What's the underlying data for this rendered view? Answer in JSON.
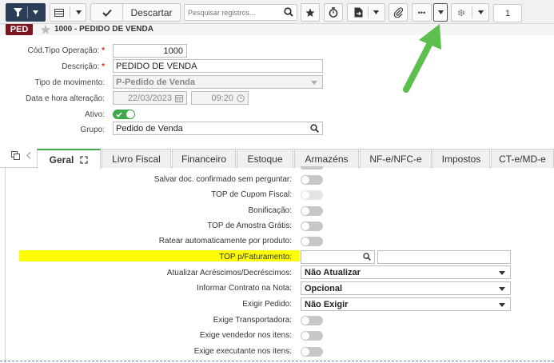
{
  "toolbar": {
    "discard_label": "Descartar",
    "search_placeholder": "Pesquisar registros...",
    "more_label": "•••",
    "page_number": "1"
  },
  "header": {
    "badge": "PED",
    "title": "1000 - PEDIDO DE VENDA"
  },
  "form": {
    "cod_tipo_operacao": {
      "label": "Cód.Tipo Operação:",
      "value": "1000"
    },
    "descricao": {
      "label": "Descrição:",
      "value": "PEDIDO DE VENDA"
    },
    "tipo_movimento": {
      "label": "Tipo de movimento:",
      "value": "P-Pedido de Venda"
    },
    "data_hora": {
      "label": "Data e hora alteração:",
      "date": "22/03/2023",
      "time": "09:20"
    },
    "ativo": {
      "label": "Ativo:",
      "on": true
    },
    "grupo": {
      "label": "Grupo:",
      "value": "Pedido de Venda"
    }
  },
  "tabs": [
    {
      "label": "Geral",
      "active": true
    },
    {
      "label": "Livro Fiscal"
    },
    {
      "label": "Financeiro"
    },
    {
      "label": "Estoque"
    },
    {
      "label": "Armazéns"
    },
    {
      "label": "NF-e/NFC-e"
    },
    {
      "label": "Impostos"
    },
    {
      "label": "CT-e/MD-e"
    }
  ],
  "general": {
    "salvar_doc": {
      "label": "Salvar doc. confirmado sem perguntar:",
      "on": false
    },
    "top_cupom": {
      "label": "TOP de Cupom Fiscal:",
      "on": false,
      "disabled": true
    },
    "bonificacao": {
      "label": "Bonificação:",
      "on": false
    },
    "top_amostra": {
      "label": "TOP de Amostra Grátis:",
      "on": false
    },
    "ratear": {
      "label": "Ratear automaticamente por produto:",
      "on": false
    },
    "top_faturamento": {
      "label": "TOP p/Faturamento:",
      "value": "",
      "description": ""
    },
    "atualizar_acrescimos": {
      "label": "Atualizar Acréscimos/Decréscimos:",
      "value": "Não Atualizar"
    },
    "informar_contrato": {
      "label": "Informar Contrato na Nota:",
      "value": "Opcional"
    },
    "exigir_pedido": {
      "label": "Exigir Pedido:",
      "value": "Não Exigir"
    },
    "exige_transportadora": {
      "label": "Exige Transportadora:",
      "on": false
    },
    "exige_vendedor": {
      "label": "Exige vendedor nos itens:",
      "on": false
    },
    "exige_executante": {
      "label": "Exige executante nos itens:",
      "on": false
    }
  },
  "colors": {
    "toolbar_dark": "#2c3e55",
    "badge": "#7b1520",
    "tab_active_accent": "#3ea84a",
    "toggle_on": "#3ea84a",
    "highlight": "#ffff00",
    "annotation_arrow": "#5cc04d"
  }
}
